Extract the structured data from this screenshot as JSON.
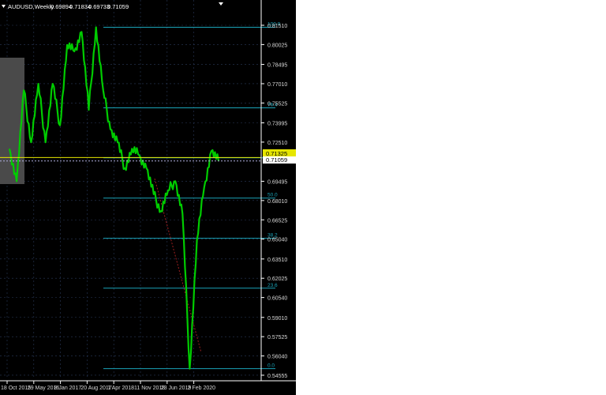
{
  "header": {
    "symbol": "AUDUSD,Weekly",
    "open": "0.69894",
    "high": "0.71834",
    "low": "0.69733",
    "close": "0.71059"
  },
  "colors": {
    "background": "#000000",
    "candle": "#00cc00",
    "grid": "#2a3a5a",
    "fib_line": "#1aa3b8",
    "fib_text": "#1aa3b8",
    "axis_text": "#d8d8d8",
    "bid_line": "#e6e600",
    "ask_line": "#b0b0e0",
    "trend_line": "#a02020",
    "panel": "#4a4a4a"
  },
  "icons": {
    "collapse": "triangle-down-icon",
    "scroll": "triangle-down-icon"
  },
  "chart_data": {
    "type": "line",
    "title": "AUDUSD,Weekly",
    "xlabel": "",
    "ylabel": "",
    "ylim": [
      0.5431,
      0.8224
    ],
    "x_ticks": [
      "18 Oct 2015",
      "29 May 2016",
      "8 Jan 2017",
      "20 Aug 2017",
      "1 Apr 2018",
      "11 Nov 2018",
      "23 Jun 2019",
      "2 Feb 2020"
    ],
    "y_ticks": [
      "0.81510",
      "0.80025",
      "0.78495",
      "0.77010",
      "0.75525",
      "0.73995",
      "0.72510",
      "0.69495",
      "0.68010",
      "0.66525",
      "0.65040",
      "0.63510",
      "0.62025",
      "0.60540",
      "0.59010",
      "0.57525",
      "0.56040",
      "0.54555"
    ],
    "bid_price": "0.71325",
    "ask_price": "0.71059",
    "grid": true,
    "fibonacci": {
      "high": 0.8136,
      "low": 0.5506,
      "levels": [
        {
          "label": "100.0",
          "value": 0.8136
        },
        {
          "label": "76.4",
          "value": 0.7515
        },
        {
          "label": "61.8",
          "value": 0.713
        },
        {
          "label": "50.0",
          "value": 0.682
        },
        {
          "label": "38.2",
          "value": 0.651
        },
        {
          "label": "23.6",
          "value": 0.6126
        },
        {
          "label": "0.0",
          "value": 0.5506
        }
      ]
    },
    "trend_line": {
      "from": {
        "x": "1 Apr 2018",
        "y": 0.697
      },
      "to": {
        "x": "2 Feb 2020",
        "y": 0.563
      }
    },
    "price_path": [
      {
        "x": "18 Oct 2015",
        "y": 0.72
      },
      {
        "x": "Jan 2016",
        "y": 0.695
      },
      {
        "x": "Apr 2016",
        "y": 0.765
      },
      {
        "x": "29 May 2016",
        "y": 0.725
      },
      {
        "x": "Aug 2016",
        "y": 0.77
      },
      {
        "x": "8 Jan 2017",
        "y": 0.725
      },
      {
        "x": "Mar 2017",
        "y": 0.77
      },
      {
        "x": "May 2017",
        "y": 0.738
      },
      {
        "x": "Jul 2017",
        "y": 0.8
      },
      {
        "x": "20 Aug 2017",
        "y": 0.795
      },
      {
        "x": "Sep 2017",
        "y": 0.81
      },
      {
        "x": "Dec 2017",
        "y": 0.75
      },
      {
        "x": "Jan 2018",
        "y": 0.8136
      },
      {
        "x": "1 Apr 2018",
        "y": 0.765
      },
      {
        "x": "Jun 2018",
        "y": 0.735
      },
      {
        "x": "Aug 2018",
        "y": 0.725
      },
      {
        "x": "Oct 2018",
        "y": 0.705
      },
      {
        "x": "11 Nov 2018",
        "y": 0.72
      },
      {
        "x": "Feb 2019",
        "y": 0.715
      },
      {
        "x": "Apr 2019",
        "y": 0.705
      },
      {
        "x": "23 Jun 2019",
        "y": 0.685
      },
      {
        "x": "Aug 2019",
        "y": 0.672
      },
      {
        "x": "Oct 2019",
        "y": 0.688
      },
      {
        "x": "Dec 2019",
        "y": 0.695
      },
      {
        "x": "2 Feb 2020",
        "y": 0.67
      },
      {
        "x": "Mar 2020",
        "y": 0.5506
      },
      {
        "x": "Apr 2020",
        "y": 0.65
      },
      {
        "x": "May 2020",
        "y": 0.69
      },
      {
        "x": "Jul 2020",
        "y": 0.7183
      },
      {
        "x": "Jul 2020 close",
        "y": 0.7106
      }
    ]
  }
}
